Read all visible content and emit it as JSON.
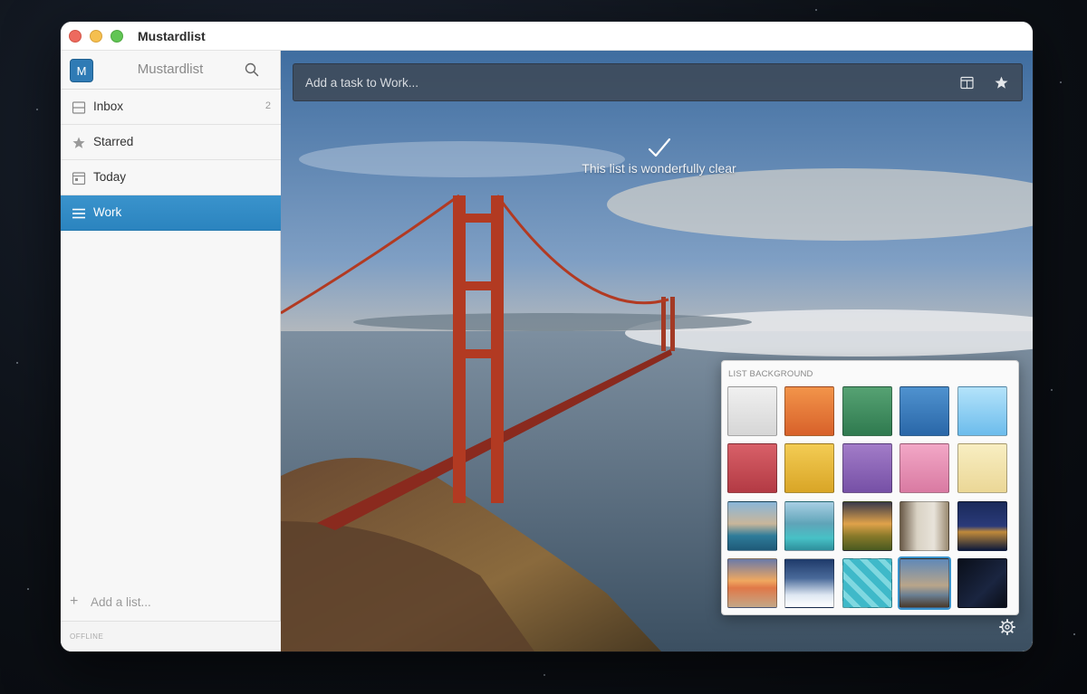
{
  "window": {
    "title": "Mustardlist"
  },
  "sidebar": {
    "avatar_letter": "M",
    "app_name": "Mustardlist",
    "items": [
      {
        "label": "Inbox",
        "count": "2",
        "icon": "inbox-icon"
      },
      {
        "label": "Starred",
        "count": "",
        "icon": "star-icon"
      },
      {
        "label": "Today",
        "count": "",
        "icon": "calendar-icon"
      },
      {
        "label": "Work",
        "count": "",
        "icon": "list-icon",
        "active": true
      }
    ],
    "add_list_label": "Add a list...",
    "status": "OFFLINE"
  },
  "main": {
    "add_task_placeholder": "Add a task to Work...",
    "empty_message": "This list is wonderfully clear",
    "background_picker": {
      "title": "LIST BACKGROUND",
      "solid_colors": [
        "#e6e6e6",
        "#e8752f",
        "#3e8a5c",
        "#3778b8",
        "#8fd0f2",
        "#c8474f",
        "#e6b53a",
        "#8a62b6",
        "#e48fb3",
        "#f1e2a6"
      ],
      "photo_themes": [
        "coastal-town",
        "tropical-lagoon",
        "golden-field",
        "room-interior",
        "city-night",
        "beach-sunset",
        "snowy-forest",
        "cloud-pattern",
        "golden-gate-bridge",
        "dark-sky"
      ],
      "selected": "golden-gate-bridge"
    }
  },
  "colors": {
    "accent": "#2b84bf"
  }
}
